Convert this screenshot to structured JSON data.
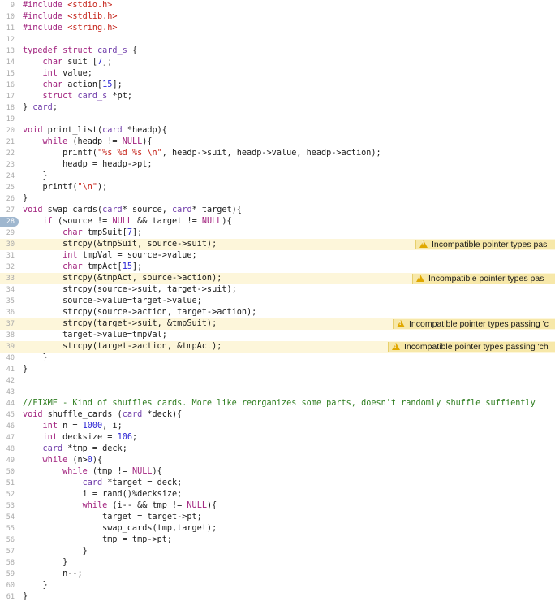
{
  "editor": {
    "current_line": "28",
    "warning_text": "Incompatible pointer types pas",
    "warning_text_b": "Incompatible pointer types passing 'c",
    "warning_text_c": "Incompatible pointer types passing 'ch",
    "colors": {
      "keyword": "#a1227e",
      "preprocessor": "#6e3b1f",
      "string": "#c5241b",
      "number": "#2b24d4",
      "comment": "#2e7d1f",
      "warning_bg": "#fdf6da",
      "badge_bg": "#f7e8a9"
    },
    "lines": [
      {
        "n": "9",
        "code": "#include <stdio.h>"
      },
      {
        "n": "10",
        "code": "#include <stdlib.h>"
      },
      {
        "n": "11",
        "code": "#include <string.h>"
      },
      {
        "n": "12",
        "code": ""
      },
      {
        "n": "13",
        "code": "typedef struct card_s {"
      },
      {
        "n": "14",
        "code": "    char suit [7];"
      },
      {
        "n": "15",
        "code": "    int value;"
      },
      {
        "n": "16",
        "code": "    char action[15];"
      },
      {
        "n": "17",
        "code": "    struct card_s *pt;"
      },
      {
        "n": "18",
        "code": "} card;"
      },
      {
        "n": "19",
        "code": ""
      },
      {
        "n": "20",
        "code": "void print_list(card *headp){"
      },
      {
        "n": "21",
        "code": "    while (headp != NULL){"
      },
      {
        "n": "22",
        "code": "        printf(\"%s %d %s \\n\", headp->suit, headp->value, headp->action);"
      },
      {
        "n": "23",
        "code": "        headp = headp->pt;"
      },
      {
        "n": "24",
        "code": "    }"
      },
      {
        "n": "25",
        "code": "    printf(\"\\n\");"
      },
      {
        "n": "26",
        "code": "}"
      },
      {
        "n": "27",
        "code": "void swap_cards(card* source, card* target){"
      },
      {
        "n": "28",
        "code": "    if (source != NULL && target != NULL){"
      },
      {
        "n": "29",
        "code": "        char tmpSuit[7];"
      },
      {
        "n": "30",
        "code": "        strcpy(&tmpSuit, source->suit);"
      },
      {
        "n": "31",
        "code": "        int tmpVal = source->value;"
      },
      {
        "n": "32",
        "code": "        char tmpAct[15];"
      },
      {
        "n": "33",
        "code": "        strcpy(&tmpAct, source->action);"
      },
      {
        "n": "34",
        "code": "        strcpy(source->suit, target->suit);"
      },
      {
        "n": "35",
        "code": "        source->value=target->value;"
      },
      {
        "n": "36",
        "code": "        strcpy(source->action, target->action);"
      },
      {
        "n": "37",
        "code": "        strcpy(target->suit, &tmpSuit);"
      },
      {
        "n": "38",
        "code": "        target->value=tmpVal;"
      },
      {
        "n": "39",
        "code": "        strcpy(target->action, &tmpAct);"
      },
      {
        "n": "40",
        "code": "    }"
      },
      {
        "n": "41",
        "code": "}"
      },
      {
        "n": "42",
        "code": ""
      },
      {
        "n": "43",
        "code": ""
      },
      {
        "n": "44",
        "code": "//FIXME - Kind of shuffles cards. More like reorganizes some parts, doesn't randomly shuffle suffiently"
      },
      {
        "n": "45",
        "code": "void shuffle_cards (card *deck){"
      },
      {
        "n": "46",
        "code": "    int n = 1000, i;"
      },
      {
        "n": "47",
        "code": "    int decksize = 106;"
      },
      {
        "n": "48",
        "code": "    card *tmp = deck;"
      },
      {
        "n": "49",
        "code": "    while (n>0){"
      },
      {
        "n": "50",
        "code": "        while (tmp != NULL){"
      },
      {
        "n": "51",
        "code": "            card *target = deck;"
      },
      {
        "n": "52",
        "code": "            i = rand()%decksize;"
      },
      {
        "n": "53",
        "code": "            while (i-- && tmp != NULL){"
      },
      {
        "n": "54",
        "code": "                target = target->pt;"
      },
      {
        "n": "55",
        "code": "                swap_cards(tmp,target);"
      },
      {
        "n": "56",
        "code": "                tmp = tmp->pt;"
      },
      {
        "n": "57",
        "code": "            }"
      },
      {
        "n": "58",
        "code": "        }"
      },
      {
        "n": "59",
        "code": "        n--;"
      },
      {
        "n": "60",
        "code": "    }"
      },
      {
        "n": "61",
        "code": "}"
      }
    ]
  }
}
